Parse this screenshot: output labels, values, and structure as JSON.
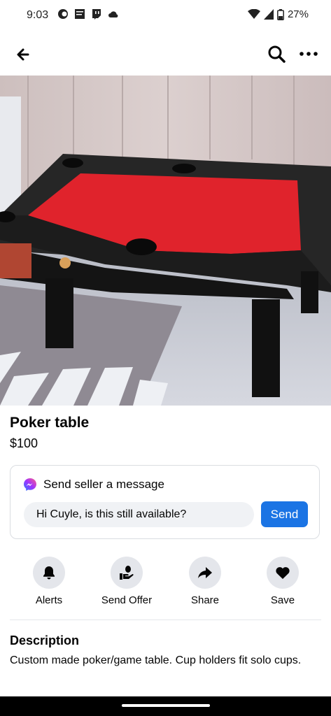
{
  "status_bar": {
    "time": "9:03",
    "battery": "27%"
  },
  "listing": {
    "title": "Poker table",
    "price": "$100"
  },
  "message": {
    "header": "Send seller a message",
    "input_value": "Hi Cuyle, is this still available?",
    "send_label": "Send"
  },
  "actions": [
    {
      "label": "Alerts",
      "icon": "bell-icon"
    },
    {
      "label": "Send Offer",
      "icon": "offer-hand-icon"
    },
    {
      "label": "Share",
      "icon": "share-arrow-icon"
    },
    {
      "label": "Save",
      "icon": "heart-icon"
    }
  ],
  "description": {
    "title": "Description",
    "text": "Custom made poker/game table. Cup holders fit solo cups."
  },
  "colors": {
    "accent": "#1b74e4",
    "felt": "#e0232c"
  }
}
